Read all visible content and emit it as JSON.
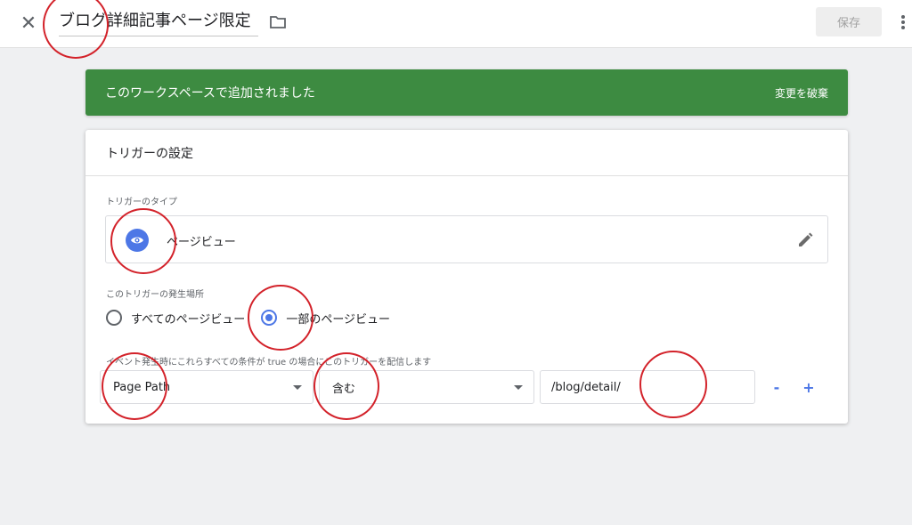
{
  "header": {
    "title": "ブログ詳細記事ページ限定",
    "save_label": "保存",
    "close_glyph": "✕",
    "icons": [
      "close-icon",
      "folder-icon",
      "more-vert-icon"
    ]
  },
  "banner": {
    "message": "このワークスペースで追加されました",
    "action": "変更を破棄",
    "color": "#3d8b41"
  },
  "card": {
    "title": "トリガーの設定",
    "trigger_type_label": "トリガーのタイプ",
    "trigger_type": "ページビュー",
    "fires_on_label": "このトリガーの発生場所",
    "fires_on_options": [
      {
        "label": "すべてのページビュー",
        "selected": false
      },
      {
        "label": "一部のページビュー",
        "selected": true
      }
    ],
    "condition_label": "イベント発生時にこれらすべての条件が true の場合にこのトリガーを配信します",
    "condition": {
      "variable": "Page Path",
      "operator": "含む",
      "value": "/blog/detail/",
      "remove_glyph": "-",
      "add_glyph": "+"
    }
  },
  "colors": {
    "accent": "#4d77e6",
    "annotation": "#d3222a"
  }
}
